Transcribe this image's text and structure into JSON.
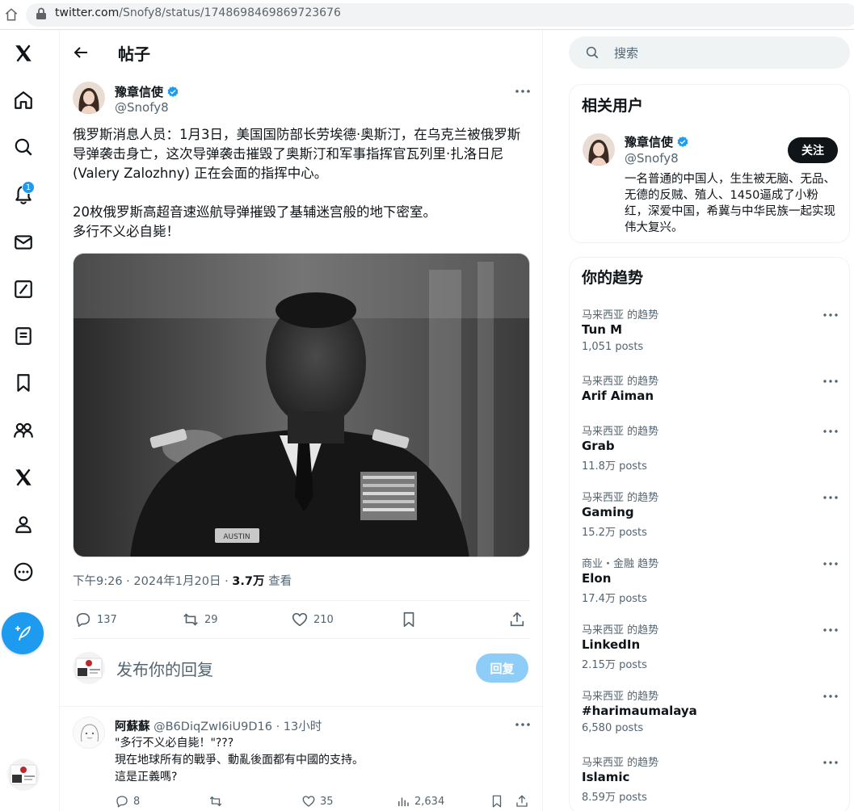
{
  "browser": {
    "url_host": "twitter.com",
    "url_path": "/Snofy8/status/1748698469869723676"
  },
  "nav": {
    "notification_count": "1"
  },
  "header": {
    "title": "帖子"
  },
  "post": {
    "author_name": "豫章信使",
    "author_handle": "@Snofy8",
    "paragraphs": [
      "俄罗斯消息人员：1月3日，美国国防部长劳埃德·奥斯汀，在乌克兰被俄罗斯导弹袭击身亡，这次导弹袭击摧毁了奥斯汀和军事指挥官瓦列里·扎洛日尼 (Valery Zalozhny) 正在会面的指挥中心。",
      "20枚俄罗斯高超音速巡航导弹摧毁了基辅迷宫般的地下密室。\n多行不义必自毙！"
    ],
    "time": "下午9:26",
    "date": "2024年1月20日",
    "views": "3.7万",
    "views_label": "查看",
    "replies": "137",
    "reposts": "29",
    "likes": "210",
    "image_badge_text": "AUSTIN"
  },
  "reply_box": {
    "placeholder": "发布你的回复",
    "button": "回复"
  },
  "comment": {
    "name": "阿蘇蘇",
    "handle": "@B6DiqZwI6iU9D16",
    "time": "13小时",
    "lines": [
      "\"多行不义必自毙！\"???",
      "現在地球所有的戰爭、動亂後面都有中國的支持。",
      "這是正義嗎?"
    ],
    "replies": "8",
    "likes": "35",
    "views": "2,634"
  },
  "search": {
    "placeholder": "搜索"
  },
  "related": {
    "title": "相关用户",
    "name": "豫章信使",
    "handle": "@Snofy8",
    "follow": "关注",
    "bio": "一名普通的中国人，生生被无脑、无品、无德的反贼、殖人、1450逼成了小粉红，深爱中国，希冀与中华民族一起实现伟大复兴。"
  },
  "trends": {
    "title": "你的趋势",
    "items": [
      {
        "context": "马来西亚 的趋势",
        "name": "Tun M",
        "posts": "1,051 posts"
      },
      {
        "context": "马来西亚 的趋势",
        "name": "Arif Aiman",
        "posts": ""
      },
      {
        "context": "马来西亚 的趋势",
        "name": "Grab",
        "posts": "11.8万 posts"
      },
      {
        "context": "马来西亚 的趋势",
        "name": "Gaming",
        "posts": "15.2万 posts"
      },
      {
        "context": "商业・金融 趋势",
        "name": "Elon",
        "posts": "17.4万 posts"
      },
      {
        "context": "马来西亚 的趋势",
        "name": "LinkedIn",
        "posts": "2.15万 posts"
      },
      {
        "context": "马来西亚 的趋势",
        "name": "#harimaumalaya",
        "posts": "6,580 posts"
      },
      {
        "context": "马来西亚 的趋势",
        "name": "Islamic",
        "posts": "8.59万 posts"
      }
    ]
  },
  "colors": {
    "accent": "#1d9bf0",
    "text": "#0f1419",
    "muted": "#536471",
    "border": "#eff3f4"
  }
}
